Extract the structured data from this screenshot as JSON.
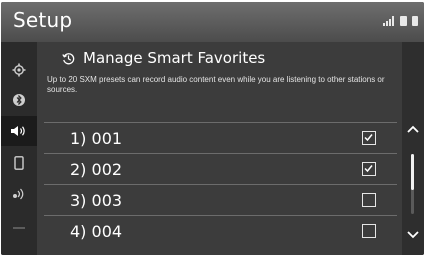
{
  "header": {
    "title": "Setup"
  },
  "sidebar": {
    "items": [
      {
        "name": "general-settings",
        "icon": "gear-icon"
      },
      {
        "name": "bluetooth",
        "icon": "bluetooth-icon"
      },
      {
        "name": "sound",
        "icon": "speaker-icon",
        "selected": true
      },
      {
        "name": "phone",
        "icon": "phone-icon"
      },
      {
        "name": "voice",
        "icon": "voice-icon"
      }
    ]
  },
  "panel": {
    "title": "Manage Smart Favorites",
    "description": "Up to 20 SXM presets can record audio content even while you are listening to other stations or sources.",
    "rows": [
      {
        "label": "1) 001",
        "checked": true
      },
      {
        "label": "2) 002",
        "checked": true
      },
      {
        "label": "3) 003",
        "checked": false
      },
      {
        "label": "4) 004",
        "checked": false
      }
    ]
  },
  "colors": {
    "background": "#3c3c3c",
    "header": "#5a5a5a",
    "text": "#ffffff"
  }
}
